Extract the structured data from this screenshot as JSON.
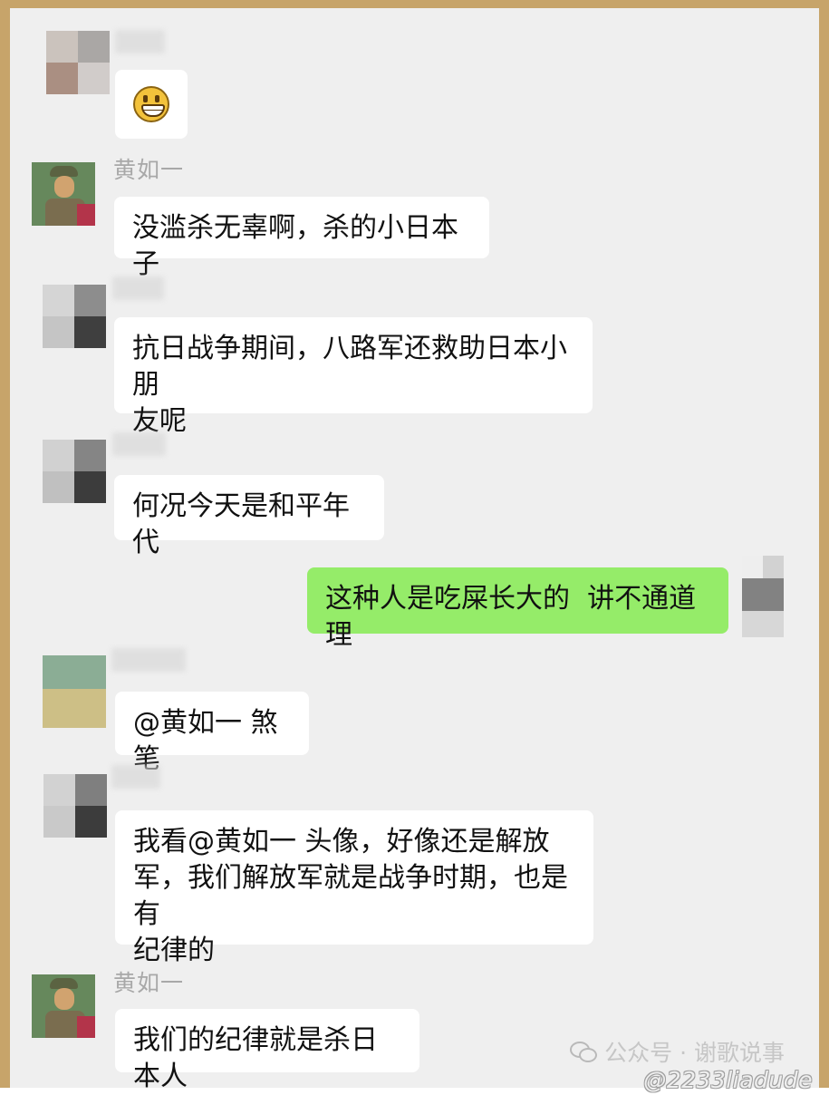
{
  "chat": {
    "messages": [
      {
        "sender_name": "",
        "text": "",
        "emoji_icon": "grinning-face-icon"
      },
      {
        "sender_name": "黄如一",
        "text": "没滥杀无辜啊，杀的小日本子"
      },
      {
        "sender_name": "",
        "text": "抗日战争期间，八路军还救助日本小朋\n友呢"
      },
      {
        "sender_name": "",
        "text": "何况今天是和平年代"
      },
      {
        "sender_name": "",
        "text": "这种人是吃屎长大的  讲不通道理",
        "own_message": true
      },
      {
        "sender_name": "",
        "text": "@黄如一 煞笔"
      },
      {
        "sender_name": "",
        "text": "我看@黄如一 头像，好像还是解放\n军，我们解放军就是战争时期，也是有\n纪律的"
      },
      {
        "sender_name": "黄如一",
        "text": "我们的纪律就是杀日本人"
      }
    ]
  },
  "watermarks": {
    "public_account": "公众号 · 谢歌说事",
    "weibo_handle": "@2233liadude",
    "wechat_icon": "wechat-icon"
  },
  "colors": {
    "frame": "#c7a46a",
    "chat_background": "#efefef",
    "incoming_bubble": "#ffffff",
    "outgoing_bubble": "#95ec69",
    "sender_name": "#a8a8a8"
  }
}
